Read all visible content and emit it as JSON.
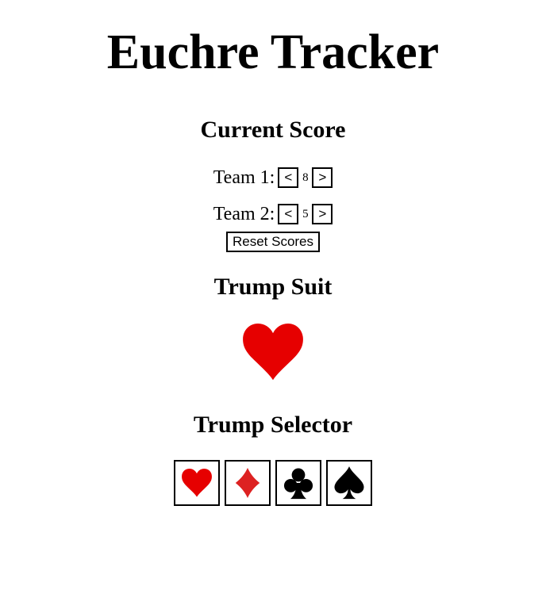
{
  "title": "Euchre Tracker",
  "score": {
    "heading": "Current Score",
    "teams": [
      {
        "label": "Team 1:",
        "value": "8"
      },
      {
        "label": "Team 2:",
        "value": "5"
      }
    ],
    "decrement_label": "<",
    "increment_label": ">",
    "reset_label": "Reset Scores"
  },
  "trump": {
    "heading": "Trump Suit",
    "current_icon": "heart-icon",
    "current_color": "#e60000"
  },
  "selector": {
    "heading": "Trump Selector",
    "suits": [
      {
        "icon": "heart-icon",
        "color": "#e60000"
      },
      {
        "icon": "diamond-icon",
        "color": "#dd2222"
      },
      {
        "icon": "club-icon",
        "color": "#000000"
      },
      {
        "icon": "spade-icon",
        "color": "#000000"
      }
    ]
  }
}
